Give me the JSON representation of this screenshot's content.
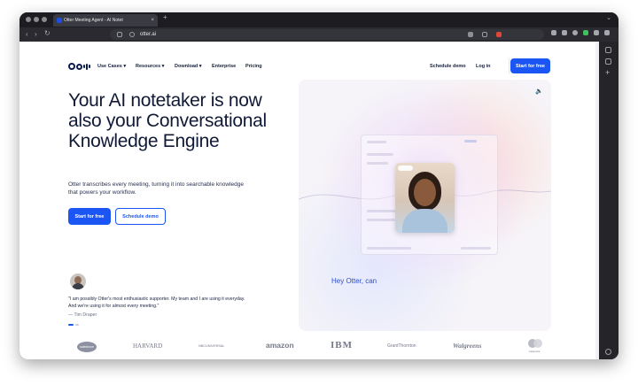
{
  "browser": {
    "tab_title": "Otter Meeting Agent - AI Notet",
    "tab_close": "×",
    "new_tab": "+",
    "url": "otter.ai",
    "tab_chevron": "⌄",
    "back": "‹",
    "forward": "›",
    "reload": "↻",
    "sidebar_add": "+"
  },
  "nav": {
    "items": [
      "Use Cases ▾",
      "Resources ▾",
      "Download ▾",
      "Enterprise",
      "Pricing"
    ],
    "schedule_demo": "Schedule demo",
    "login": "Log in",
    "start_free": "Start for free"
  },
  "hero": {
    "headline": "Your AI notetaker is now also your Conversational Knowledge Engine",
    "subtext": "Otter transcribes every meeting, turning it into searchable knowledge that powers your workflow.",
    "cta_primary": "Start for free",
    "cta_secondary": "Schedule demo",
    "speaker_icon": "🔈",
    "caption": "Hey Otter, can"
  },
  "testimonial": {
    "quote": "\"I am possibly Otter's most enthusiastic supporter. My team and I are using it everyday. And we're using it for almost every meeting.\"",
    "author": "— Tim Draper"
  },
  "customers": [
    "salesforce",
    "HARVARD",
    "NBCUNIVERSAL",
    "amazon",
    "IBM",
    "GrantThornton",
    "Walgreens",
    "mastercard"
  ],
  "colors": {
    "accent": "#1b55f4",
    "headline": "#101a36",
    "caption": "#2b4fd6"
  }
}
